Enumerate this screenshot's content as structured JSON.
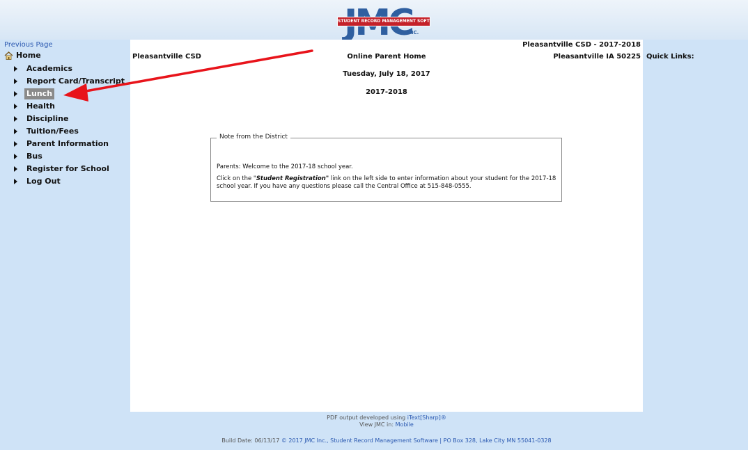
{
  "header": {
    "logo_letters": "JMC",
    "logo_banner": "STUDENT RECORD MANAGEMENT SOFTWARE",
    "logo_inc": "INC."
  },
  "nav": {
    "previous_page": "Previous Page",
    "home": "Home",
    "items": [
      {
        "label": "Academics"
      },
      {
        "label": "Report Card/Transcript"
      },
      {
        "label": "Lunch",
        "active": true
      },
      {
        "label": "Health"
      },
      {
        "label": "Discipline"
      },
      {
        "label": "Tuition/Fees"
      },
      {
        "label": "Parent Information"
      },
      {
        "label": "Bus"
      },
      {
        "label": "Register for School"
      },
      {
        "label": "Log Out"
      }
    ]
  },
  "main": {
    "district_left": "Pleasantville CSD",
    "heading": "Online Parent Home",
    "date": "Tuesday, July 18, 2017",
    "year": "2017-2018",
    "district_right_line1": "Pleasantville CSD - 2017-2018",
    "district_right_line2": "Pleasantville IA 50225"
  },
  "note": {
    "legend": "Note from the District",
    "p1": "Parents:  Welcome to the 2017-18 school year.",
    "p2_pre": "Click on the \"",
    "p2_bold": "Student Registration\"",
    "p2_post": " link on the left side to enter information about your student for the 2017-18 school year.  If you have any questions please call the Central Office at 515-848-0555."
  },
  "quick_links": "Quick Links:",
  "footer": {
    "pdf_pre": "PDF output developed using ",
    "pdf_link": "iText[Sharp]®",
    "view_pre": "View JMC in: ",
    "view_link": "Mobile",
    "build_pre": "Build Date: 06/13/17 ",
    "build_link": "© 2017 JMC Inc., Student Record Management Software | PO Box 328, Lake City MN 55041-0328"
  },
  "colors": {
    "background": "#cfe3f7",
    "link": "#2a58b0",
    "active_item": "#8a8a8a",
    "arrow": "#e8141b",
    "logo_blue": "#2f5fa0",
    "logo_red": "#c42129"
  }
}
